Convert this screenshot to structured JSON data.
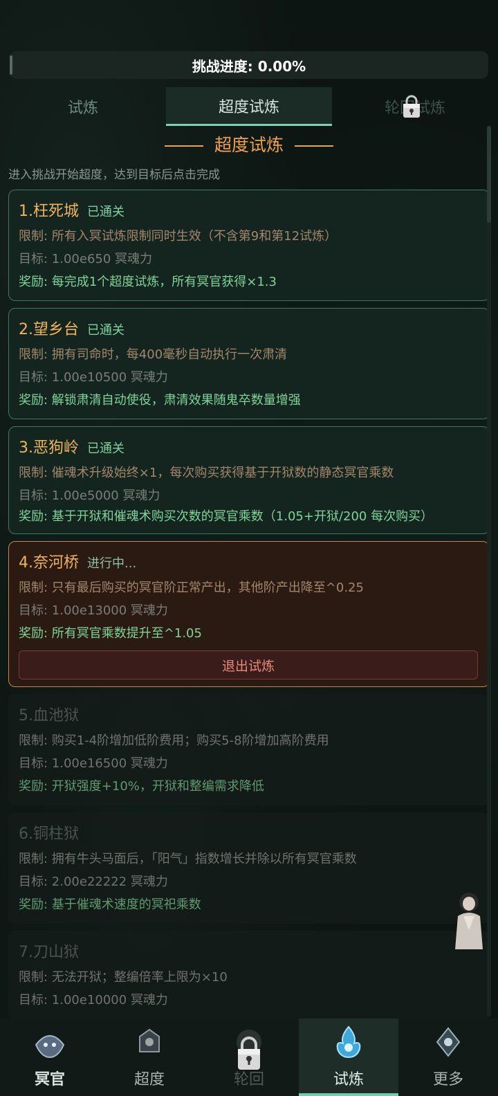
{
  "progress": {
    "label": "挑战进度: 0.00%"
  },
  "tabs": [
    {
      "label": "试炼",
      "locked": false
    },
    {
      "label": "超度试炼",
      "locked": false,
      "active": true
    },
    {
      "label": "轮回试炼",
      "locked": true
    }
  ],
  "section": {
    "title": "超度试炼",
    "intro": "进入挑战开始超度，达到目标后点击完成"
  },
  "cards": [
    {
      "name": "1.枉死城",
      "status": "已通关",
      "limit": "限制: 所有入冥试炼限制同时生效（不含第9和第12试炼）",
      "target": "目标: 1.00e650 冥魂力",
      "reward": "奖励: 每完成1个超度试炼，所有冥官获得×1.3"
    },
    {
      "name": "2.望乡台",
      "status": "已通关",
      "limit": "限制: 拥有司命时，每400毫秒自动执行一次肃清",
      "target": "目标: 1.00e10500 冥魂力",
      "reward": "奖励: 解锁肃清自动使役，肃清效果随鬼卒数量增强"
    },
    {
      "name": "3.恶狗岭",
      "status": "已通关",
      "limit": "限制: 催魂术升级始终×1，每次购买获得基于开狱数的静态冥官乘数",
      "target": "目标: 1.00e5000 冥魂力",
      "reward": "奖励: 基于开狱和催魂术购买次数的冥官乘数（1.05+开狱/200 每次购买）"
    },
    {
      "name": "4.奈河桥",
      "status": "进行中...",
      "limit": "限制: 只有最后购买的冥官阶正常产出，其他阶产出降至^0.25",
      "target": "目标: 1.00e13000 冥魂力",
      "reward": "奖励: 所有冥官乘数提升至^1.05",
      "exit_label": "退出试炼"
    },
    {
      "name": "5.血池狱",
      "status": "",
      "limit": "限制: 购买1-4阶增加低阶费用；购买5-8阶增加高阶费用",
      "target": "目标: 1.00e16500 冥魂力",
      "reward": "奖励: 开狱强度+10%，开狱和整编需求降低"
    },
    {
      "name": "6.铜柱狱",
      "status": "",
      "limit": "限制: 拥有牛头马面后，「阳气」指数增长并除以所有冥官乘数",
      "target": "目标: 2.00e22222 冥魂力",
      "reward": "奖励: 基于催魂术速度的冥祀乘数"
    },
    {
      "name": "7.刀山狱",
      "status": "",
      "limit": "限制: 无法开狱；整编倍率上限为×10",
      "target": "目标: 1.00e10000 冥魂力",
      "reward": ""
    }
  ],
  "nav": [
    {
      "label": "冥官",
      "icon": "ghost-official-icon"
    },
    {
      "label": "超度",
      "icon": "redemption-icon"
    },
    {
      "label": "轮回",
      "icon": "lock-icon",
      "locked": true
    },
    {
      "label": "试炼",
      "icon": "blue-flame-icon",
      "active": true
    },
    {
      "label": "更多",
      "icon": "more-icon"
    }
  ],
  "colors": {
    "accent": "#f0a24a",
    "done_border": "#3d7a5f",
    "active_border": "#c8874a",
    "reward": "#7fd49a"
  }
}
